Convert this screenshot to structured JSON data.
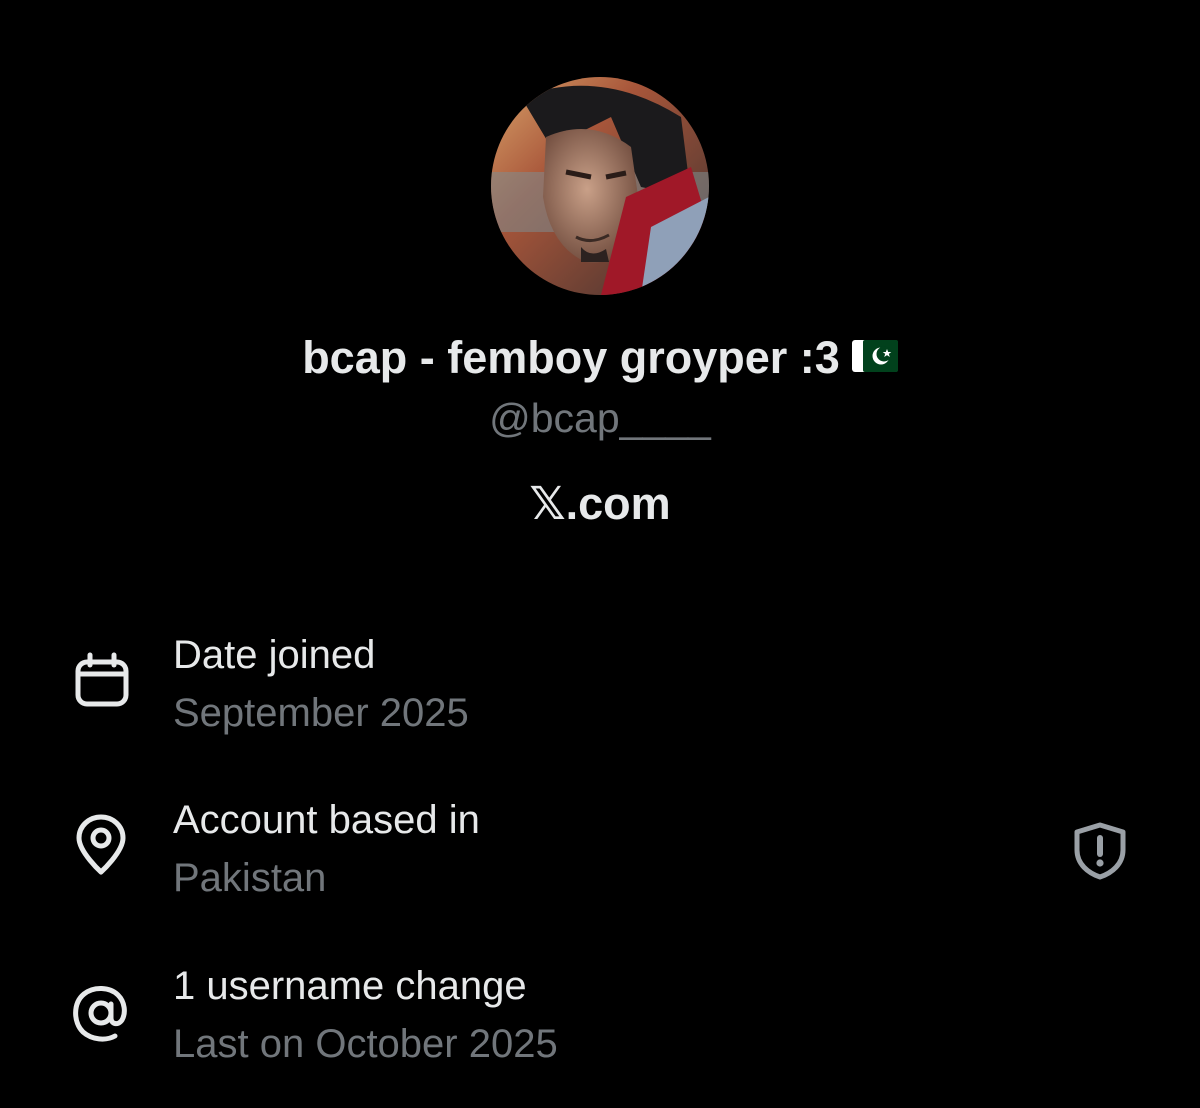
{
  "profile": {
    "display_name": "bcap - femboy groyper :3",
    "handle": "@bcap____",
    "flag_icon": "pakistan-flag-icon",
    "avatar": "profile-avatar-image"
  },
  "brand": {
    "text": "𝕏.com"
  },
  "info": {
    "date_joined": {
      "label": "Date joined",
      "value": "September 2025",
      "icon": "calendar-icon"
    },
    "location": {
      "label": "Account based in",
      "value": "Pakistan",
      "icon": "location-pin-icon",
      "action_icon": "shield-alert-icon"
    },
    "username_changes": {
      "label": "1 username change",
      "value": "Last on October 2025",
      "icon": "at-sign-icon"
    }
  },
  "colors": {
    "background": "#000000",
    "primary_text": "#e7e9ea",
    "secondary_text": "#71767b",
    "flag_green": "#01411c"
  }
}
